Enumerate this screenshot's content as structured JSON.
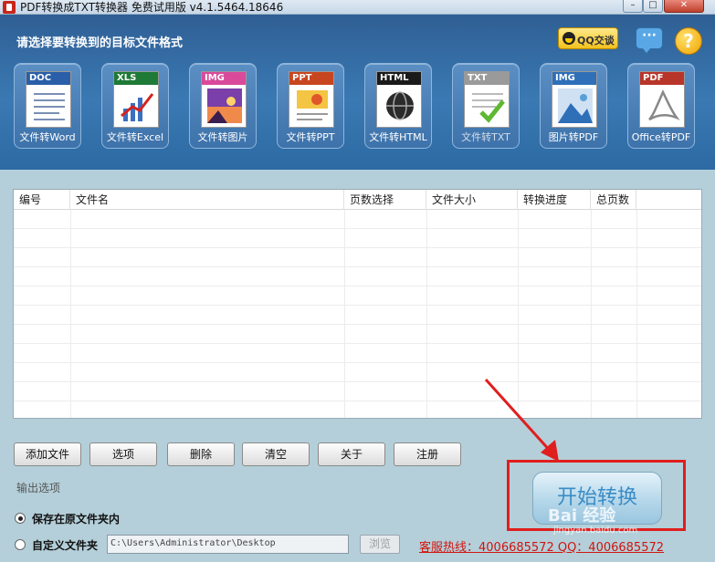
{
  "window": {
    "title": "PDF转换成TXT转换器 免费试用版 v4.1.5464.18646",
    "controls": {
      "minimize": "–",
      "maximize": "□",
      "close": "✕"
    }
  },
  "header": {
    "title": "请选择要转换到的目标文件格式",
    "qq_button": "QQ交谈",
    "help": "?"
  },
  "tools": [
    {
      "tag": "DOC",
      "label": "文件转Word",
      "tag_color": "#2a5ea8"
    },
    {
      "tag": "XLS",
      "label": "文件转Excel",
      "tag_color": "#1e7a36"
    },
    {
      "tag": "IMG",
      "label": "文件转图片",
      "tag_color": "#d94a9a"
    },
    {
      "tag": "PPT",
      "label": "文件转PPT",
      "tag_color": "#c8461f"
    },
    {
      "tag": "HTML",
      "label": "文件转HTML",
      "tag_color": "#1a1a1a"
    },
    {
      "tag": "TXT",
      "label": "文件转TXT",
      "tag_color": "#9a9a9a"
    },
    {
      "tag": "IMG",
      "label": "图片转PDF",
      "tag_color": "#2e6fb8"
    },
    {
      "tag": "PDF",
      "label": "Office转PDF",
      "tag_color": "#b8352a"
    }
  ],
  "table": {
    "columns": [
      "编号",
      "文件名",
      "页数选择",
      "文件大小",
      "转换进度",
      "总页数"
    ]
  },
  "buttons": {
    "add_file": "添加文件",
    "options": "选项",
    "delete": "删除",
    "clear": "清空",
    "about": "关于",
    "register": "注册"
  },
  "output": {
    "section_title": "输出选项",
    "save_original": "保存在原文件夹内",
    "custom_folder": "自定义文件夹",
    "path": "C:\\Users\\Administrator\\Desktop",
    "browse": "浏览",
    "selected": "save_original"
  },
  "hotline": "客服热线：4006685572 QQ：4006685572",
  "start_button": "开始转换",
  "watermark": {
    "main": "Bai 经验",
    "sub": "jingyan.baidu.com"
  }
}
